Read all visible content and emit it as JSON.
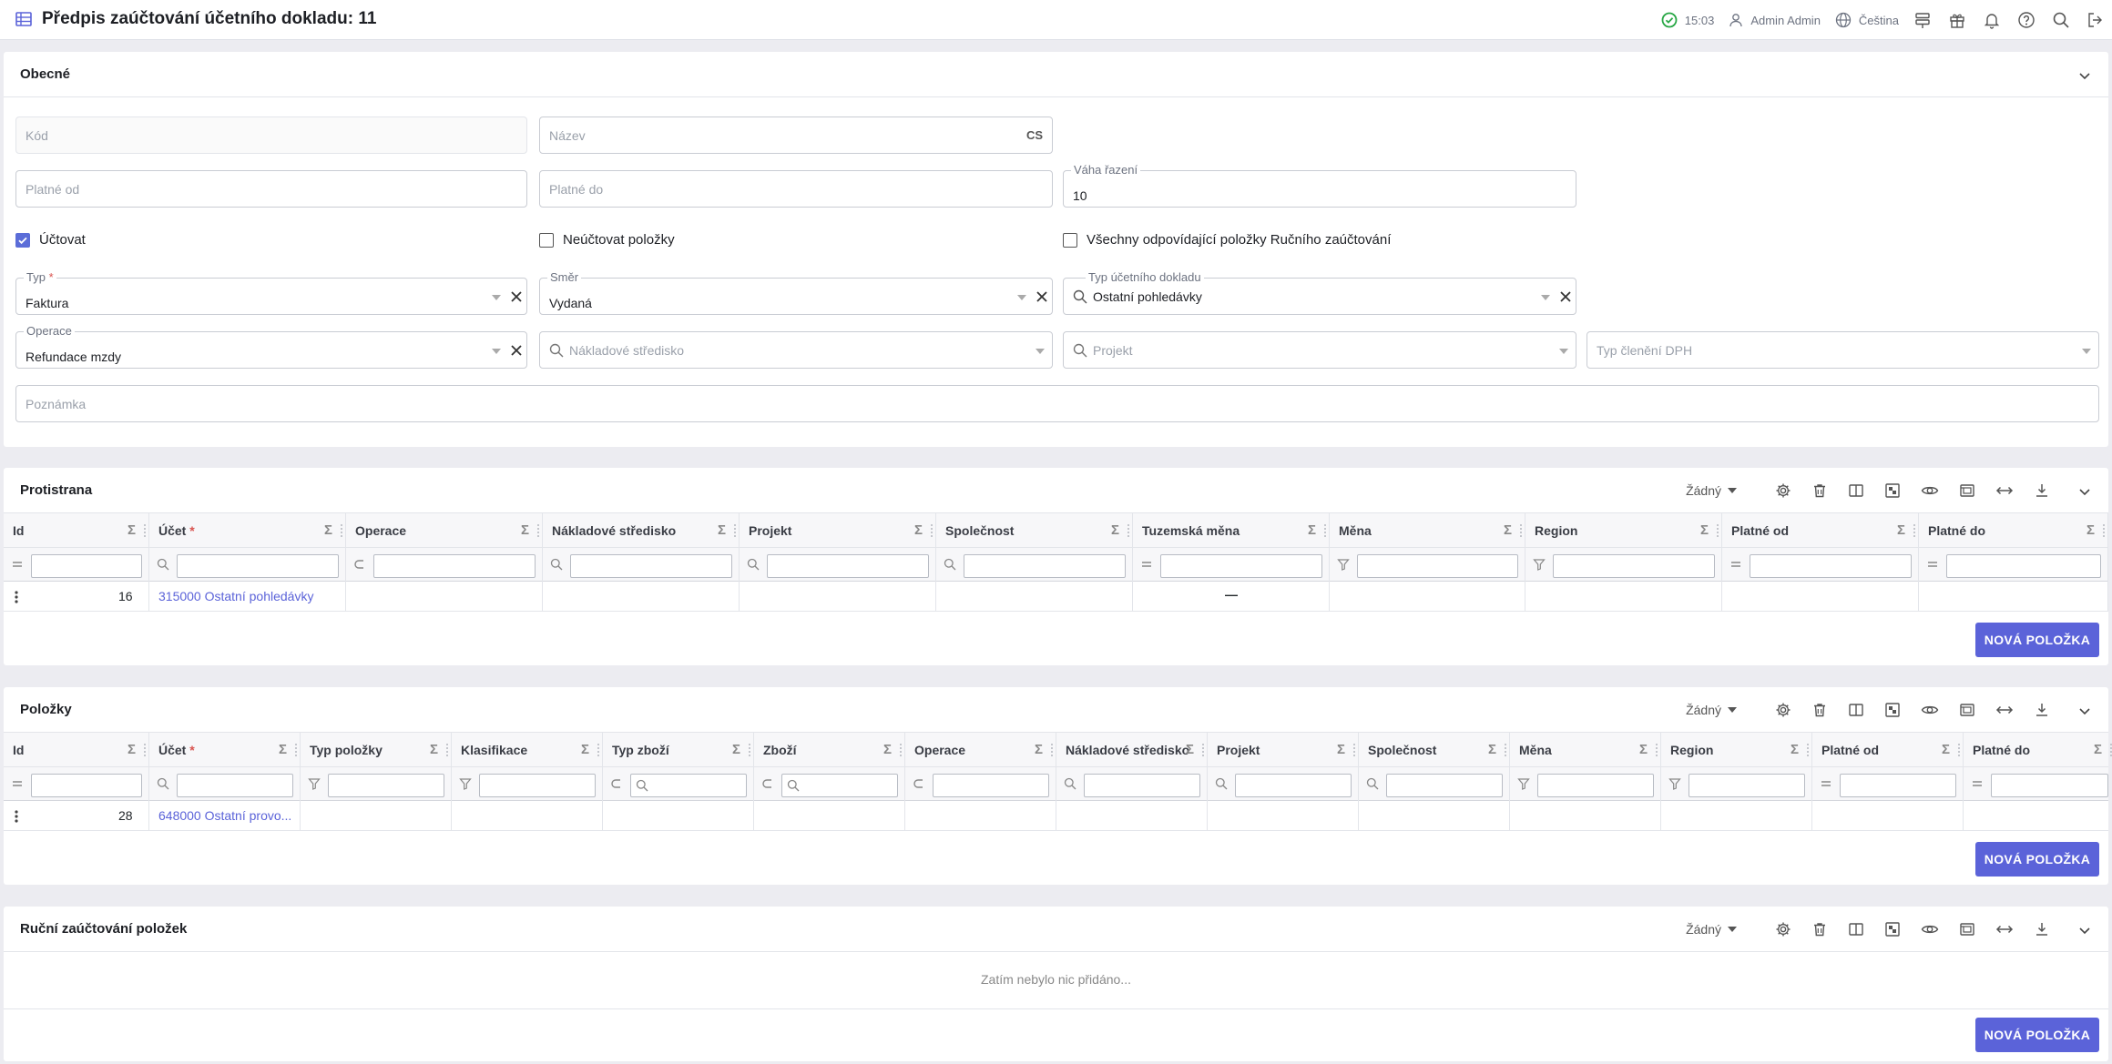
{
  "header": {
    "title": "Předpis zaúčtování účetního dokladu: 11",
    "time": "15:03",
    "user": "Admin Admin",
    "language": "Čeština"
  },
  "general": {
    "title": "Obecné",
    "kod_ph": "Kód",
    "nazev_ph": "Název",
    "nazev_lang": "CS",
    "platne_od_ph": "Platné od",
    "platne_do_ph": "Platné do",
    "vaha_label": "Váha řazení",
    "vaha_value": "10",
    "cb_uctovat": "Účtovat",
    "cb_neuctovat": "Neúčtovat položky",
    "cb_vsechny": "Všechny odpovídající položky Ručního zaúčtování",
    "typ_label": "Typ",
    "typ_req": "*",
    "typ_value": "Faktura",
    "smer_label": "Směr",
    "smer_value": "Vydaná",
    "typ_dokladu_label": "Typ účetního dokladu",
    "typ_dokladu_value": "Ostatní pohledávky",
    "operace_label": "Operace",
    "operace_value": "Refundace mzdy",
    "stredisko_ph": "Nákladové středisko",
    "projekt_ph": "Projekt",
    "dph_ph": "Typ členění DPH",
    "poznamka_ph": "Poznámka"
  },
  "protistrana": {
    "title": "Protistrana",
    "select": "Žádný",
    "columns": [
      "Id",
      "Účet",
      "Operace",
      "Nákladové středisko",
      "Projekt",
      "Společnost",
      "Tuzemská měna",
      "Měna",
      "Region",
      "Platné od",
      "Platné do"
    ],
    "row": {
      "id": "16",
      "ucet": "315000 Ostatní pohledávky",
      "tuzemska": "—"
    },
    "button": "NOVÁ POLOŽKA"
  },
  "polozky": {
    "title": "Položky",
    "select": "Žádný",
    "columns": [
      "Id",
      "Účet",
      "Typ položky",
      "Klasifikace",
      "Typ zboží",
      "Zboží",
      "Operace",
      "Nákladové středisko",
      "Projekt",
      "Společnost",
      "Měna",
      "Region",
      "Platné od",
      "Platné do"
    ],
    "row": {
      "id": "28",
      "ucet": "648000 Ostatní provo..."
    },
    "button": "NOVÁ POLOŽKA"
  },
  "rucni": {
    "title": "Ruční zaúčtování položek",
    "select": "Žádný",
    "empty": "Zatím nebylo nic přidáno...",
    "button": "NOVÁ POLOŽKA"
  },
  "req_mark": "*",
  "sigma": "Σ",
  "colors": {
    "accent": "#5b63d9",
    "success": "#28a745",
    "required": "#d9534f"
  }
}
